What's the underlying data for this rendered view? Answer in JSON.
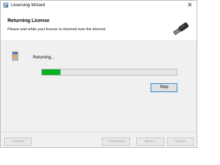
{
  "window": {
    "title": "Licensing Wizard",
    "close_glyph": "✕"
  },
  "header": {
    "title": "Returning License",
    "subtitle": "Please wait while your license is returned over the Internet."
  },
  "status": {
    "text": "Returning...",
    "progress": 0.14,
    "stop_label": "Stop"
  },
  "footer": {
    "cancel_label": "Cancel",
    "previous_label": "< Previous",
    "next_label": "Next >",
    "finish_label": "Finish"
  },
  "colors": {
    "progress_fill": "#06b025",
    "stop_border": "#3c7fb1",
    "disabled_text": "#a8a8a8"
  },
  "icons": {
    "app": "wizard-icon",
    "key": "key-icon",
    "status": "server-icon"
  }
}
